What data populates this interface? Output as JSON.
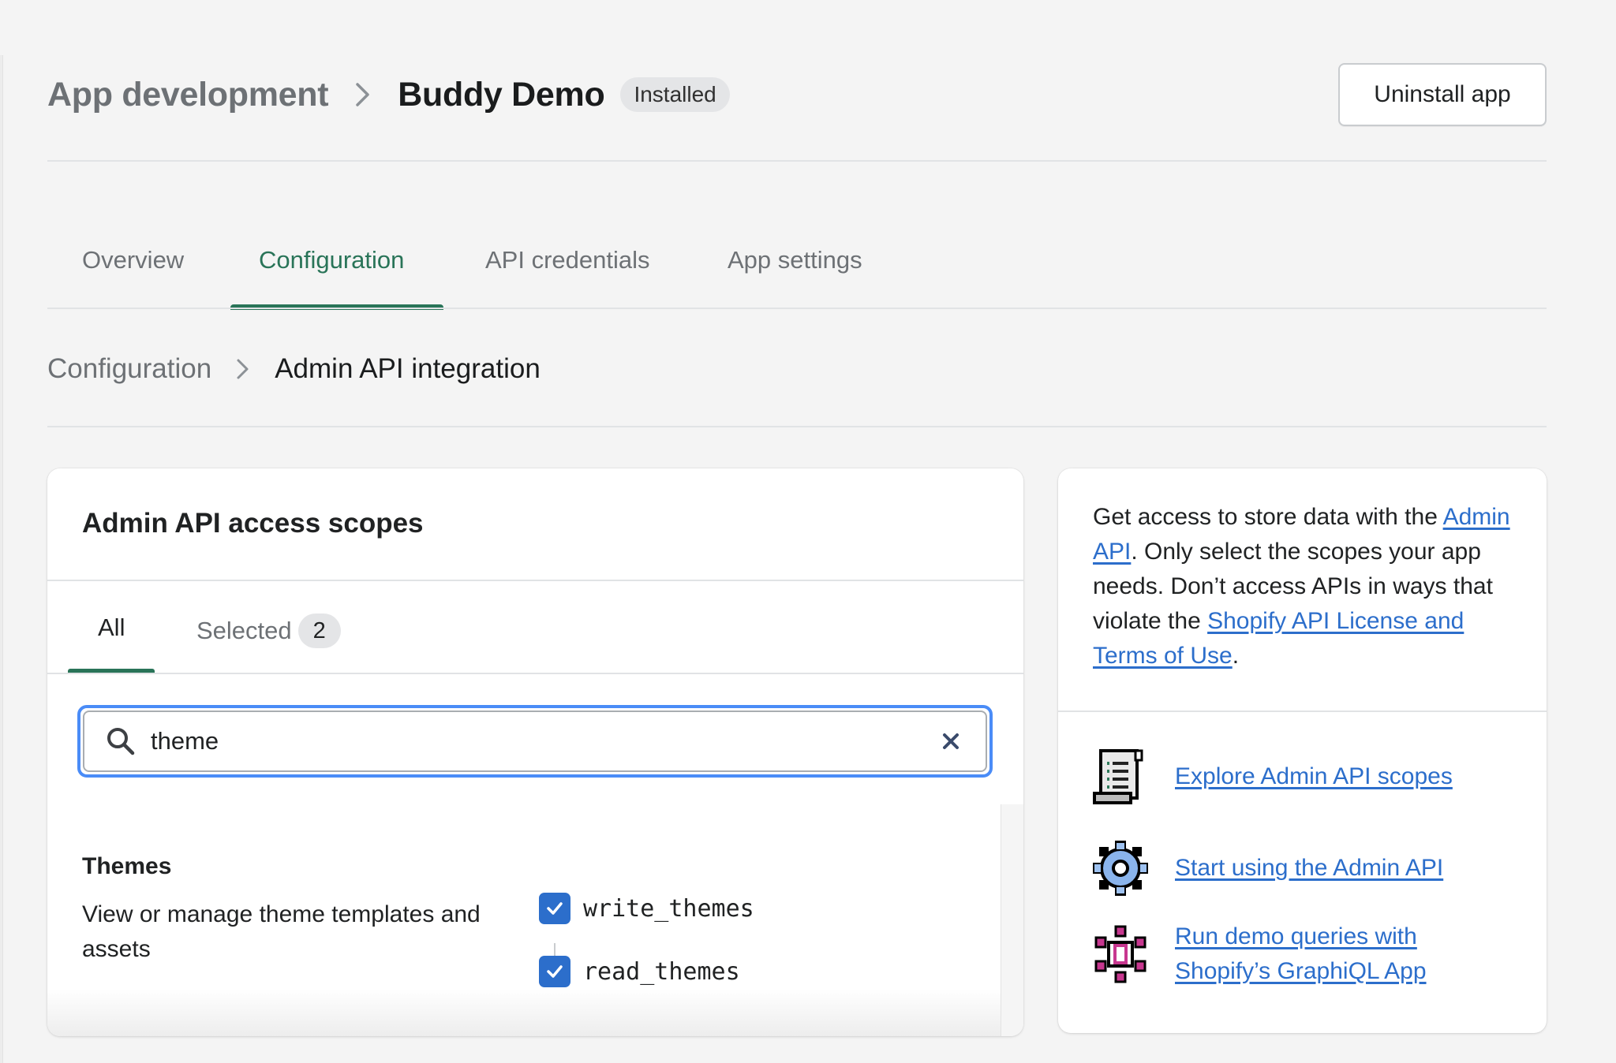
{
  "header": {
    "breadcrumb_parent": "App development",
    "app_name": "Buddy Demo",
    "status_badge": "Installed",
    "uninstall_button": "Uninstall app"
  },
  "tabs": [
    {
      "label": "Overview",
      "active": false
    },
    {
      "label": "Configuration",
      "active": true
    },
    {
      "label": "API credentials",
      "active": false
    },
    {
      "label": "App settings",
      "active": false
    }
  ],
  "subbreadcrumb": {
    "parent": "Configuration",
    "current": "Admin API integration"
  },
  "scopes_card": {
    "title": "Admin API access scopes",
    "filter_tabs": [
      {
        "label": "All",
        "active": true
      },
      {
        "label": "Selected",
        "count": "2",
        "active": false
      }
    ],
    "search": {
      "value": "theme",
      "icon": "search-icon",
      "clear_icon": "close-icon"
    },
    "groups": [
      {
        "title": "Themes",
        "description": "View or manage theme templates and assets",
        "scopes": [
          {
            "name": "write_themes",
            "checked": true
          },
          {
            "name": "read_themes",
            "checked": true
          }
        ]
      }
    ]
  },
  "info_card": {
    "text_1": "Get access to store data with the ",
    "link_1": "Admin API",
    "text_2": ". Only select the scopes your app needs. Don’t access APIs in ways that violate the ",
    "link_2": "Shopify API License and Terms of Use",
    "text_3": ".",
    "resources": [
      {
        "icon": "document-scroll-icon",
        "label": "Explore Admin API scopes"
      },
      {
        "icon": "gear-icon",
        "label": "Start using the Admin API"
      },
      {
        "icon": "graphql-icon",
        "label": "Run demo queries with Shopify’s GraphiQL App"
      }
    ]
  },
  "colors": {
    "accent_green": "#297458",
    "link_blue": "#2c6ecb",
    "focus_blue": "#4a8cf7",
    "checkbox_blue": "#2c6ecb",
    "badge_gray": "#e4e5e7"
  }
}
